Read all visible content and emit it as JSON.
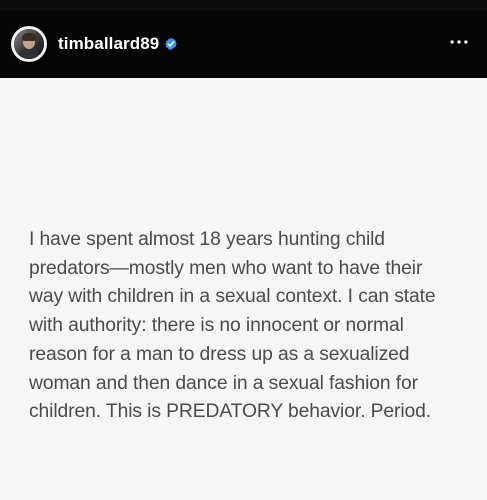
{
  "header": {
    "username": "timballard89",
    "avatar_icon": "profile-avatar-icon",
    "verified_icon": "verified-badge-icon",
    "verified_color": "#3897f0",
    "more_icon": "more-options-icon",
    "background_color": "#050505",
    "text_color": "#ffffff"
  },
  "post": {
    "text": "I have spent almost 18 years hunting child\npredators—mostly men who want to have their\nway with children in a sexual context. I can state\nwith authority: there is no innocent or normal\nreason for a man to dress up as a sexualized\nwoman and then dance in a sexual fashion for\nchildren. This is PREDATORY behavior. Period.",
    "background_color": "#f6f6f6",
    "text_color": "#4b4b4b"
  }
}
